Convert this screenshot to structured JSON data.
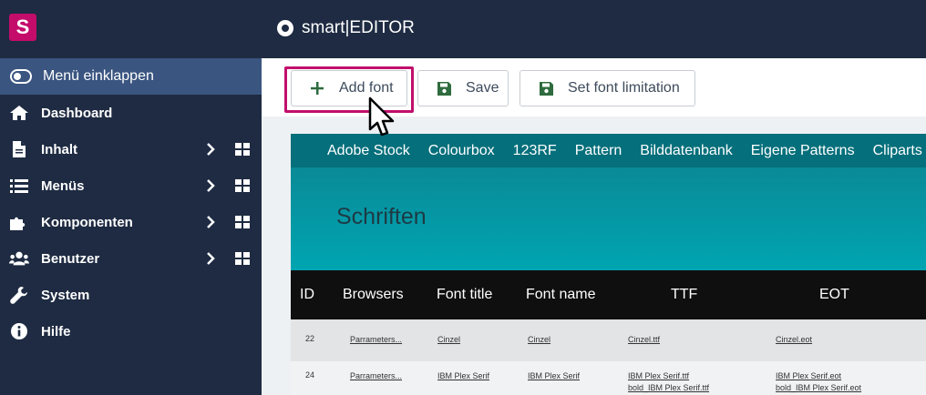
{
  "logo": {
    "letter": "S"
  },
  "topbar": {
    "title": "smart|EDITOR"
  },
  "sidebar": {
    "collapse_label": "Menü einklappen",
    "items": [
      {
        "label": "Dashboard",
        "icon": "home-icon",
        "has_submenu": false
      },
      {
        "label": "Inhalt",
        "icon": "file-icon",
        "has_submenu": true
      },
      {
        "label": "Menüs",
        "icon": "list-icon",
        "has_submenu": true
      },
      {
        "label": "Komponenten",
        "icon": "puzzle-icon",
        "has_submenu": true
      },
      {
        "label": "Benutzer",
        "icon": "users-icon",
        "has_submenu": true
      },
      {
        "label": "System",
        "icon": "wrench-icon",
        "has_submenu": false
      },
      {
        "label": "Hilfe",
        "icon": "info-icon",
        "has_submenu": false
      }
    ]
  },
  "toolbar": {
    "add_label": "Add font",
    "save_label": "Save",
    "limit_label": "Set font limitation"
  },
  "preview": {
    "menu": [
      "Adobe Stock",
      "Colourbox",
      "123RF",
      "Pattern",
      "Bilddatenbank",
      "Eigene Patterns",
      "Cliparts"
    ],
    "heading": "Schriften",
    "columns": [
      "ID",
      "Browsers",
      "Font title",
      "Font name",
      "TTF",
      "EOT"
    ],
    "rows": [
      {
        "id": "22",
        "browsers": "Parrameters...",
        "title": "Cinzel",
        "name": "Cinzel",
        "ttf": "Cinzel.ttf",
        "ttf2": "",
        "eot": "Cinzel.eot",
        "eot2": ""
      },
      {
        "id": "24",
        "browsers": "Parrameters...",
        "title": "IBM Plex Serif",
        "name": "IBM Plex Serif",
        "ttf": "IBM Plex Serif.ttf",
        "ttf2": "bold_IBM Plex Serif.ttf",
        "eot": "IBM Plex Serif.eot",
        "eot2": "bold_IBM Plex Serif.eot"
      }
    ]
  },
  "colors": {
    "sidebar": "#1e2b42",
    "accent": "#c10f6c",
    "active": "#3a5580",
    "teal": "#056f7b"
  }
}
